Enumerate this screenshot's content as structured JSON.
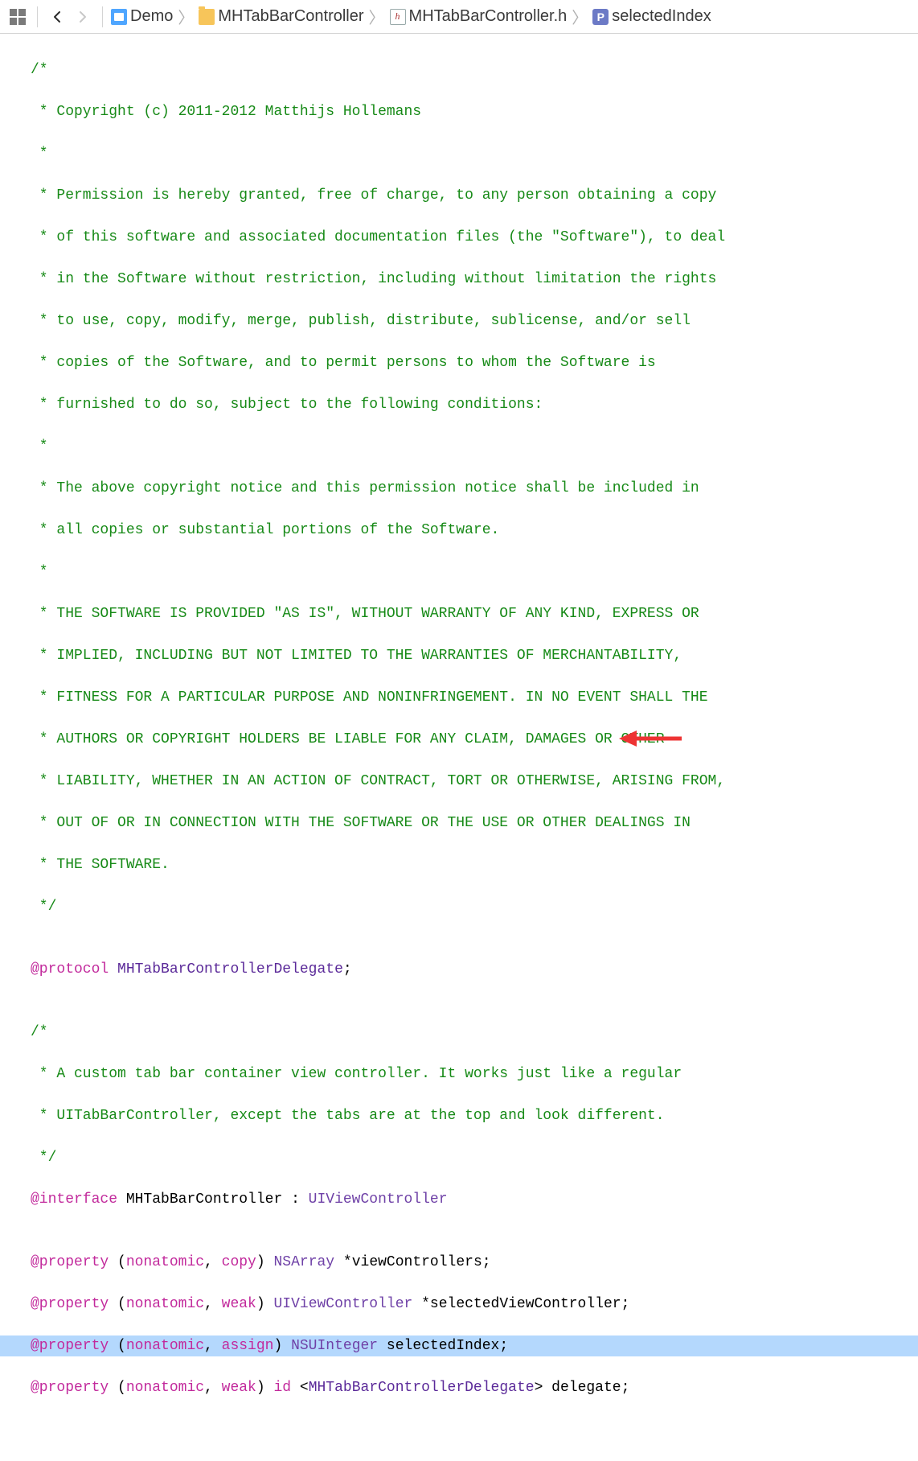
{
  "breadcrumb": {
    "project": "Demo",
    "folder": "MHTabBarController",
    "file": "MHTabBarController.h",
    "symbol": "selectedIndex",
    "header_glyph": "h",
    "property_glyph": "P"
  },
  "code": {
    "l1": "/*",
    "l2": " * Copyright (c) 2011-2012 Matthijs Hollemans",
    "l3": " *",
    "l4": " * Permission is hereby granted, free of charge, to any person obtaining a copy",
    "l5": " * of this software and associated documentation files (the \"Software\"), to deal",
    "l6": " * in the Software without restriction, including without limitation the rights",
    "l7": " * to use, copy, modify, merge, publish, distribute, sublicense, and/or sell",
    "l8": " * copies of the Software, and to permit persons to whom the Software is",
    "l9": " * furnished to do so, subject to the following conditions:",
    "l10": " *",
    "l11": " * The above copyright notice and this permission notice shall be included in",
    "l12": " * all copies or substantial portions of the Software.",
    "l13": " *",
    "l14": " * THE SOFTWARE IS PROVIDED \"AS IS\", WITHOUT WARRANTY OF ANY KIND, EXPRESS OR",
    "l15": " * IMPLIED, INCLUDING BUT NOT LIMITED TO THE WARRANTIES OF MERCHANTABILITY,",
    "l16": " * FITNESS FOR A PARTICULAR PURPOSE AND NONINFRINGEMENT. IN NO EVENT SHALL THE",
    "l17": " * AUTHORS OR COPYRIGHT HOLDERS BE LIABLE FOR ANY CLAIM, DAMAGES OR OTHER",
    "l18": " * LIABILITY, WHETHER IN AN ACTION OF CONTRACT, TORT OR OTHERWISE, ARISING FROM,",
    "l19": " * OUT OF OR IN CONNECTION WITH THE SOFTWARE OR THE USE OR OTHER DEALINGS IN",
    "l20": " * THE SOFTWARE.",
    "l21": " */",
    "l22": "",
    "l23_kw": "@protocol",
    "l23_type": " MHTabBarControllerDelegate",
    "l23_end": ";",
    "l24": "",
    "l25": "/*",
    "l26": " * A custom tab bar container view controller. It works just like a regular",
    "l27": " * UITabBarController, except the tabs are at the top and look different.",
    "l28": " */",
    "l29_kw": "@interface",
    "l29_name": " MHTabBarController : ",
    "l29_type": "UIViewController",
    "l30": "",
    "p1_kw": "@property",
    "p1_open": " (",
    "p1_a1": "nonatomic",
    "p1_comma": ", ",
    "p1_a2": "copy",
    "p1_close": ") ",
    "p1_type": "NSArray",
    "p1_rest": " *viewControllers;",
    "p2_a2": "weak",
    "p2_type": "UIViewController",
    "p2_rest": " *selectedViewController;",
    "p3_a2": "assign",
    "p3_type": "NSUInteger",
    "p3_rest": " selectedIndex;",
    "p4_a2": "weak",
    "p4_type": "id",
    "p4_open": " <",
    "p4_prot": "MHTabBarControllerDelegate",
    "p4_close": "> delegate;"
  }
}
